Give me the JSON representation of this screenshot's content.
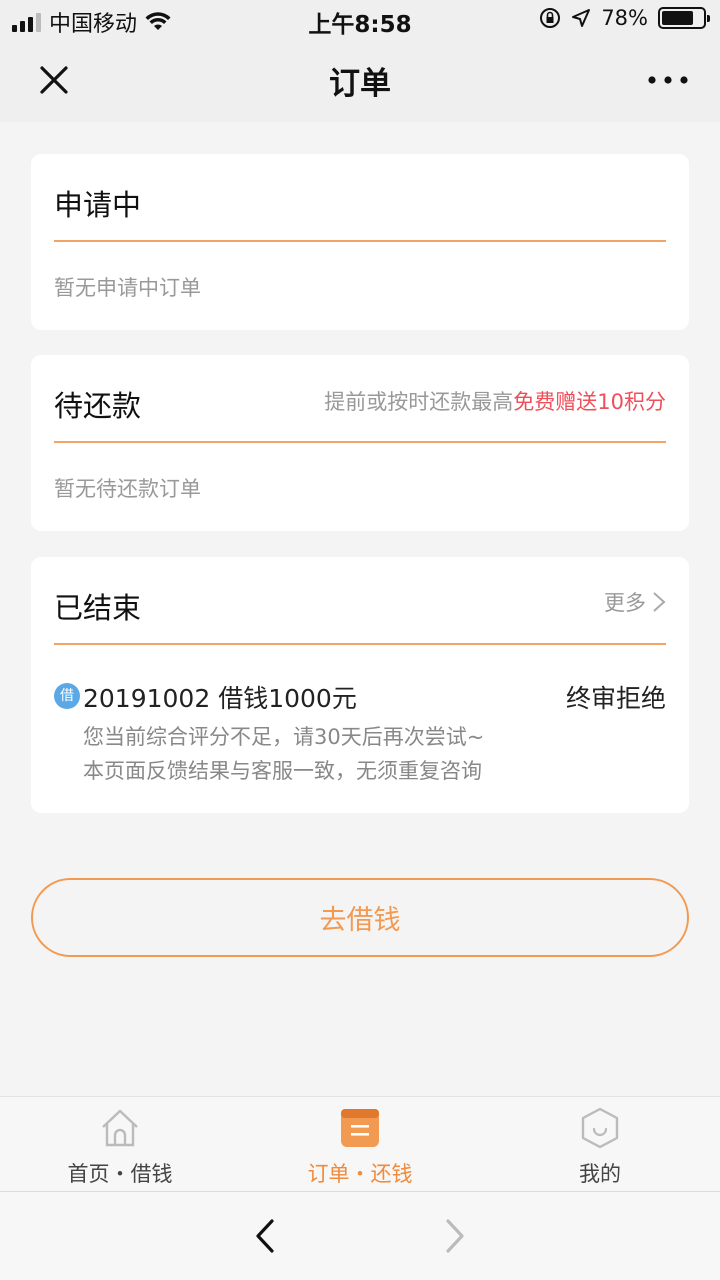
{
  "status_bar": {
    "carrier": "中国移动",
    "time": "上午8:58",
    "battery_percent": "78%",
    "battery_level": 0.78,
    "icons": [
      "signal-icon",
      "wifi-icon",
      "orientation-lock-icon",
      "location-icon",
      "battery-icon"
    ]
  },
  "nav": {
    "title": "订单",
    "left_icon": "close-icon",
    "right_icon": "more-icon"
  },
  "sections": {
    "applying": {
      "title": "申请中",
      "empty_text": "暂无申请中订单"
    },
    "repay": {
      "title": "待还款",
      "note_prefix": "提前或按时还款最高",
      "note_highlight": "免费赠送10积分",
      "empty_text": "暂无待还款订单"
    },
    "finished": {
      "title": "已结束",
      "more_label": "更多",
      "order": {
        "badge": "借",
        "title": "20191002 借钱1000元",
        "status": "终审拒绝",
        "message_line1": "您当前综合评分不足，请30天后再次尝试~",
        "message_line2": "本页面反馈结果与客服一致，无须重复咨询"
      }
    }
  },
  "borrow_button_label": "去借钱",
  "tabs": [
    {
      "label": "首页・借钱",
      "icon": "home-icon",
      "active": false
    },
    {
      "label": "订单・还钱",
      "icon": "orders-icon",
      "active": true
    },
    {
      "label": "我的",
      "icon": "profile-icon",
      "active": false
    }
  ],
  "colors": {
    "accent": "#f39a52",
    "active_tab": "#f08a3c",
    "highlight_red": "#ef4f5a",
    "badge_blue": "#5aa9e6"
  }
}
